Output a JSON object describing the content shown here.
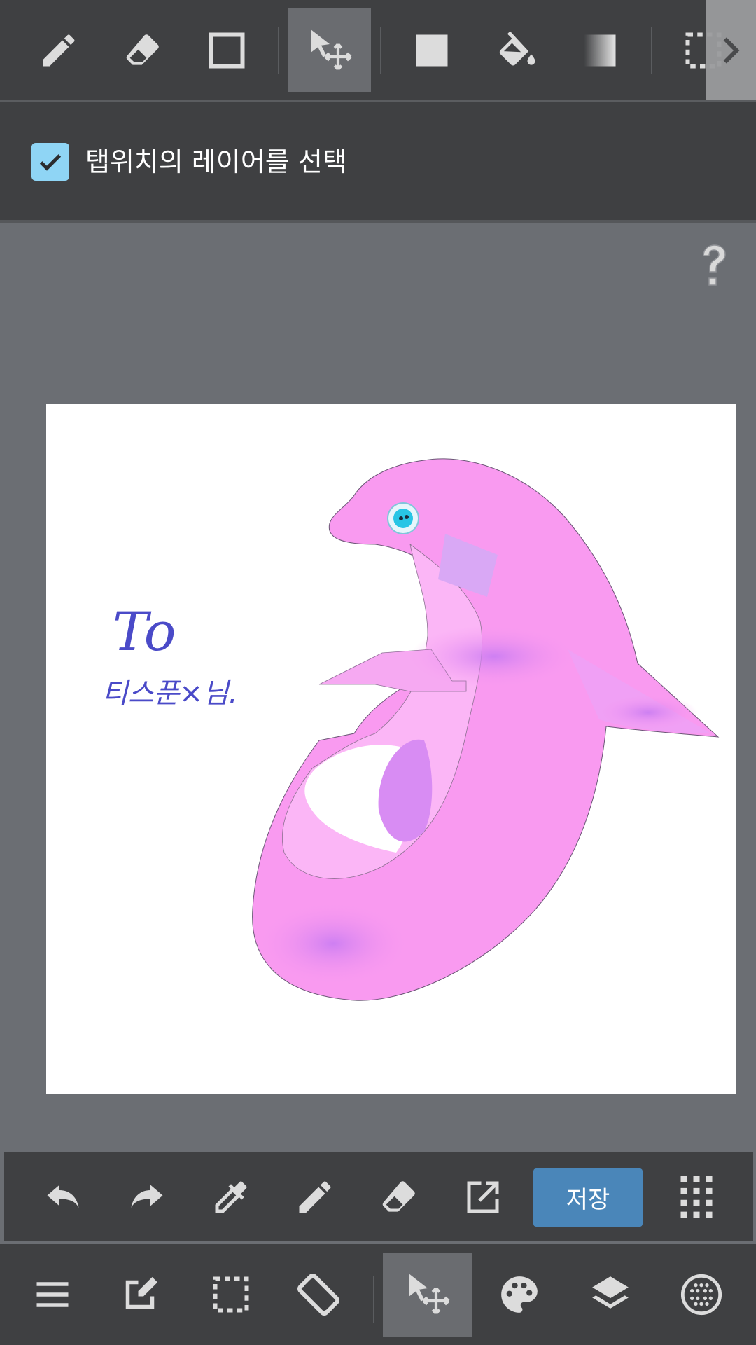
{
  "toolbar": {
    "tools": [
      {
        "icon": "pen-icon"
      },
      {
        "icon": "eraser-icon"
      },
      {
        "icon": "rectangle-icon"
      },
      {
        "icon": "move-icon",
        "active": true
      },
      {
        "icon": "fill-rect-icon"
      },
      {
        "icon": "bucket-icon"
      },
      {
        "icon": "gradient-icon"
      },
      {
        "icon": "selection-icon"
      }
    ]
  },
  "options": {
    "select_layer_checked": true,
    "select_layer_label": "탭위치의 레이어를 선택"
  },
  "canvas": {
    "drawing_text_line1": "To",
    "drawing_text_line2": "티스푼×님."
  },
  "actionbar": {
    "save_label": "저장"
  },
  "colors": {
    "bar_bg": "#3f4042",
    "canvas_area_bg": "#6b6e73",
    "save_button": "#4a86b9",
    "checkbox": "#8fd5f5",
    "dolphin_pink": "#f99af0"
  }
}
